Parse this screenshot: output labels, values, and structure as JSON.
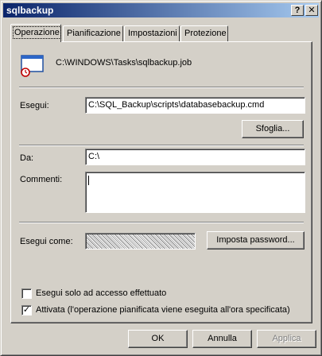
{
  "window": {
    "title": "sqlbackup",
    "help_glyph": "?",
    "close_glyph": "✕"
  },
  "tabs": [
    {
      "label": "Operazione",
      "active": true
    },
    {
      "label": "Pianificazione",
      "active": false
    },
    {
      "label": "Impostazioni",
      "active": false
    },
    {
      "label": "Protezione",
      "active": false
    }
  ],
  "task": {
    "icon": "scheduled-task-icon",
    "path": "C:\\WINDOWS\\Tasks\\sqlbackup.job"
  },
  "form": {
    "run_label": "Esegui:",
    "run_value": "C:\\SQL_Backup\\scripts\\databasebackup.cmd",
    "browse_label": "Sfoglia...",
    "start_in_label": "Da:",
    "start_in_value": "C:\\",
    "comments_label": "Commenti:",
    "comments_value": "",
    "run_as_label": "Esegui come:",
    "run_as_value": "",
    "set_password_label": "Imposta password..."
  },
  "options": {
    "only_logged_on_label": "Esegui solo ad accesso effettuato",
    "only_logged_on_checked": false,
    "enabled_label": "Attivata (l'operazione pianificata viene eseguita all'ora specificata)",
    "enabled_checked": true,
    "check_glyph": "✓"
  },
  "buttons": {
    "ok": "OK",
    "cancel": "Annulla",
    "apply": "Applica"
  }
}
